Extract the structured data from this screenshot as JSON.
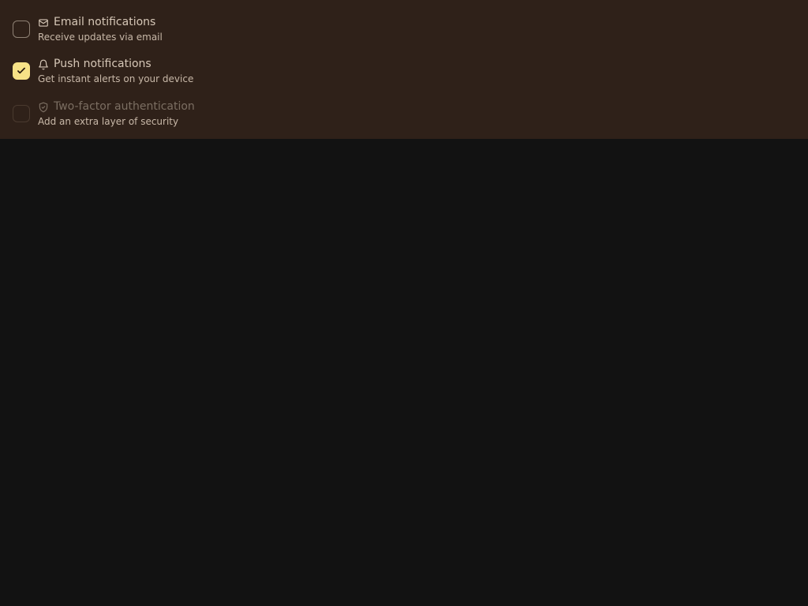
{
  "colors": {
    "background": "#121212",
    "panel": "#2f2119",
    "accent": "#f7e287",
    "text": "#d6c7b7",
    "muted": "#7b6e62"
  },
  "options": [
    {
      "title": "Email notifications",
      "description": "Receive updates via email",
      "icon": "mail-icon",
      "checked": false,
      "disabled": false
    },
    {
      "title": "Push notifications",
      "description": "Get instant alerts on your device",
      "icon": "bell-icon",
      "checked": true,
      "disabled": false
    },
    {
      "title": "Two-factor authentication",
      "description": "Add an extra layer of security",
      "icon": "shield-check-icon",
      "checked": false,
      "disabled": true
    }
  ]
}
